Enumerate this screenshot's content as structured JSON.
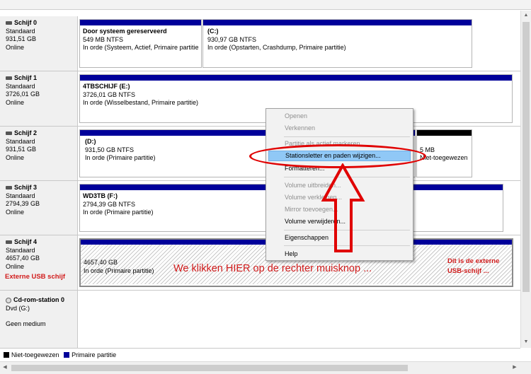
{
  "disks": [
    {
      "name": "Schijf 0",
      "type": "Standaard",
      "size": "931,51 GB",
      "status": "Online",
      "partitions": [
        {
          "name": "Door systeem gereserveerd",
          "size": "549 MB NTFS",
          "status": "In orde (Systeem, Actief, Primaire partitie"
        },
        {
          "name": "(C:)",
          "size": "930,97 GB NTFS",
          "status": "In orde (Opstarten, Crashdump, Primaire partitie)"
        }
      ]
    },
    {
      "name": "Schijf 1",
      "type": "Standaard",
      "size": "3726,01 GB",
      "status": "Online",
      "partitions": [
        {
          "name": "4TBSCHIJF  (E:)",
          "size": "3726,01 GB NTFS",
          "status": "In orde (Wisselbestand, Primaire partitie)"
        }
      ]
    },
    {
      "name": "Schijf 2",
      "type": "Standaard",
      "size": "931,51 GB",
      "status": "Online",
      "partitions": [
        {
          "name": "(D:)",
          "size": "931,50 GB NTFS",
          "status": "In orde (Primaire partitie)"
        },
        {
          "name": "",
          "size": "5 MB",
          "status": "Niet-toegewezen"
        }
      ]
    },
    {
      "name": "Schijf 3",
      "type": "Standaard",
      "size": "2794,39 GB",
      "status": "Online",
      "partitions": [
        {
          "name": "WD3TB  (F:)",
          "size": "2794,39 GB NTFS",
          "status": "In orde (Primaire partitie)"
        }
      ]
    },
    {
      "name": "Schijf 4",
      "type": "Standaard",
      "size": "4657,40 GB",
      "status": "Online",
      "annotation": "Externe USB schijf",
      "partitions": [
        {
          "name": "",
          "size": "4657,40 GB",
          "status": "In orde (Primaire partitie)"
        }
      ]
    },
    {
      "name": "Cd-rom-station 0",
      "type": "Dvd (G:)",
      "size": "",
      "status": "Geen medium",
      "partitions": []
    }
  ],
  "legend": {
    "unallocated": "Niet-toegewezen",
    "primary": "Primaire partitie",
    "unallocated_color": "#000000",
    "primary_color": "#00009a"
  },
  "context_menu": [
    {
      "label": "Openen",
      "enabled": false
    },
    {
      "label": "Verkennen",
      "enabled": false
    },
    {
      "label": "Partitie als actief markeren",
      "enabled": false
    },
    {
      "label": "Stationsletter en paden wijzigen...",
      "enabled": true,
      "highlighted": true
    },
    {
      "label": "Formatteren...",
      "enabled": true
    },
    {
      "label": "Volume uitbreiden...",
      "enabled": false
    },
    {
      "label": "Volume verkleinen...",
      "enabled": false
    },
    {
      "label": "Mirror toevoegen...",
      "enabled": false
    },
    {
      "label": "Volume verwijderen...",
      "enabled": true
    },
    {
      "label": "Eigenschappen",
      "enabled": true
    },
    {
      "label": "Help",
      "enabled": true
    }
  ],
  "annotations": {
    "main": "We klikken HIER op de rechter muisknop ...",
    "external_line1": "Dit is de externe",
    "external_line2": "USB-schijf ...",
    "color": "#d11b1b"
  },
  "icons": {
    "disk": "disk-icon",
    "cdrom": "cdrom-icon",
    "arrow": "up-arrow-annotation"
  }
}
